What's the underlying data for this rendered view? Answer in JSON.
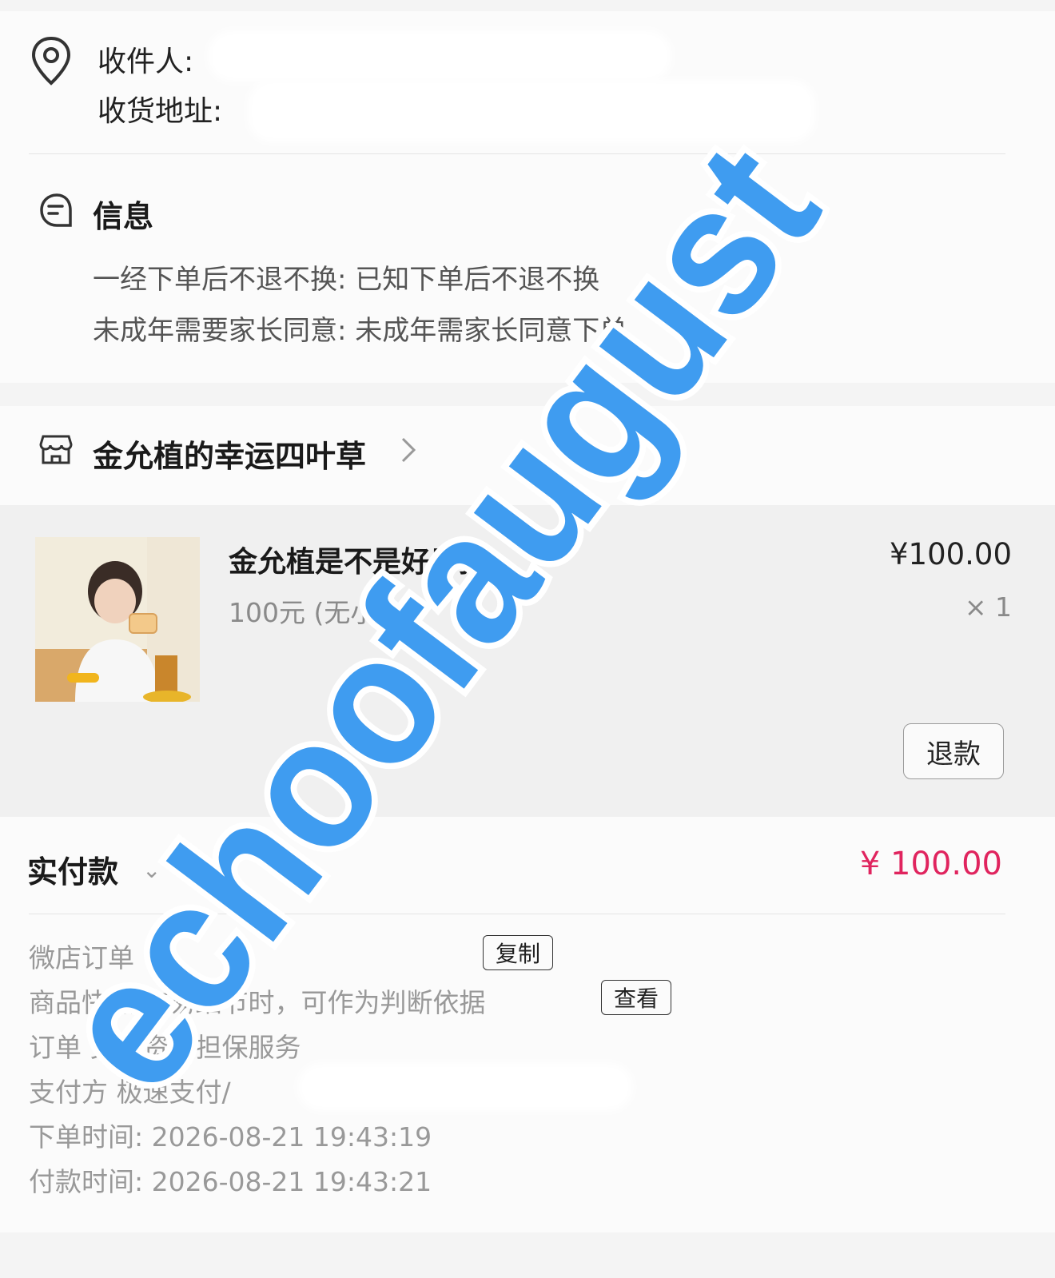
{
  "address": {
    "recipient_label": "收件人:",
    "address_label": "收货地址:"
  },
  "info": {
    "title": "信息",
    "lines": [
      "一经下单后不退不换: 已知下单后不退不换",
      "未成年需要家长同意: 未成年需家长同意下单"
    ]
  },
  "shop": {
    "name": "金允植的幸运四叶草"
  },
  "product": {
    "name": "金允植是不是好男孩",
    "spec": "100元 (无小卡)",
    "price": "¥100.00",
    "quantity": "× 1",
    "refund_label": "退款"
  },
  "payment": {
    "paid_label": "实付款",
    "paid_amount": "¥ 100.00",
    "copy_label": "复制",
    "view_label": "查看",
    "rows": [
      "微店订单",
      "商品快照 交易细节时，可作为判断依据",
      "订单 交易资金担保服务",
      "支付方 极速支付/",
      "下单时间:  2026-08-21 19:43:19",
      "付款时间:  2026-08-21 19:43:21"
    ]
  },
  "watermark": {
    "text": "echoofaugust",
    "color": "#3f9cf0"
  }
}
